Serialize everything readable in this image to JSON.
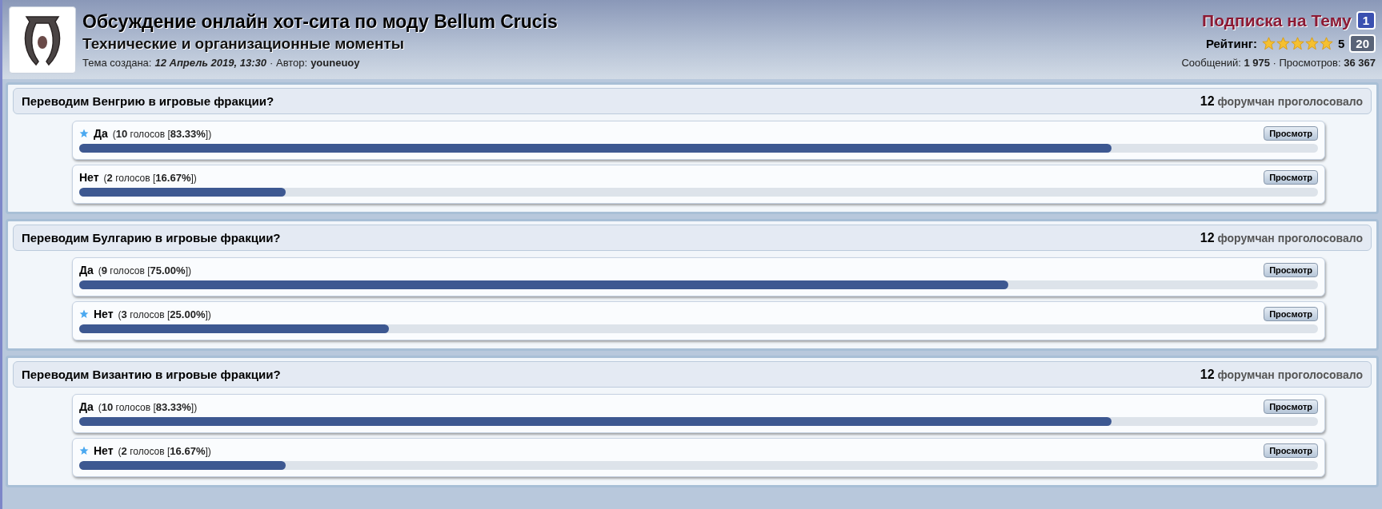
{
  "topic": {
    "title": "Обсуждение онлайн хот-сита по моду Bellum Crucis",
    "subtitle": "Технические и организационные моменты",
    "created_label": "Тема создана:",
    "created": "12 Апрель 2019, 13:30",
    "author_label": "· Автор:",
    "author": "youneuoy",
    "subscribe": "Подписка на Тему",
    "subscribe_count": "1",
    "rating_label": "Рейтинг:",
    "stars": 5,
    "rating_value": "5",
    "rating_count": "20",
    "stats": "Сообщений: **1 975** · Просмотров: **36 367**"
  },
  "polls": [
    {
      "question": "Переводим Венгрию в игровые фракции?",
      "votes": "**12** форумчан проголосовало",
      "options": [
        {
          "label": "Да",
          "result": "(**10** голосов [**83.33%**])",
          "level": 0.8333,
          "voted": true,
          "button": "Просмотр"
        },
        {
          "label": "Нет",
          "result": "(**2** голосов [**16.67%**])",
          "level": 0.1667,
          "voted": false,
          "button": "Просмотр"
        }
      ]
    },
    {
      "question": "Переводим Булгарию в игровые фракции?",
      "votes": "**12** форумчан проголосовало",
      "options": [
        {
          "label": "Да",
          "result": "(**9** голосов [**75.00%**])",
          "level": 0.75,
          "voted": false,
          "button": "Просмотр"
        },
        {
          "label": "Нет",
          "result": "(**3** голосов [**25.00%**])",
          "level": 0.25,
          "voted": true,
          "button": "Просмотр"
        }
      ]
    },
    {
      "question": "Переводим Византию в игровые фракции?",
      "votes": "**12** форумчан проголосовало",
      "options": [
        {
          "label": "Да",
          "result": "(**10** голосов [**83.33%**])",
          "level": 0.8333,
          "voted": false,
          "button": "Просмотр"
        },
        {
          "label": "Нет",
          "result": "(**2** голосов [**16.67%**])",
          "level": 0.1667,
          "voted": true,
          "button": "Просмотр"
        }
      ]
    }
  ]
}
